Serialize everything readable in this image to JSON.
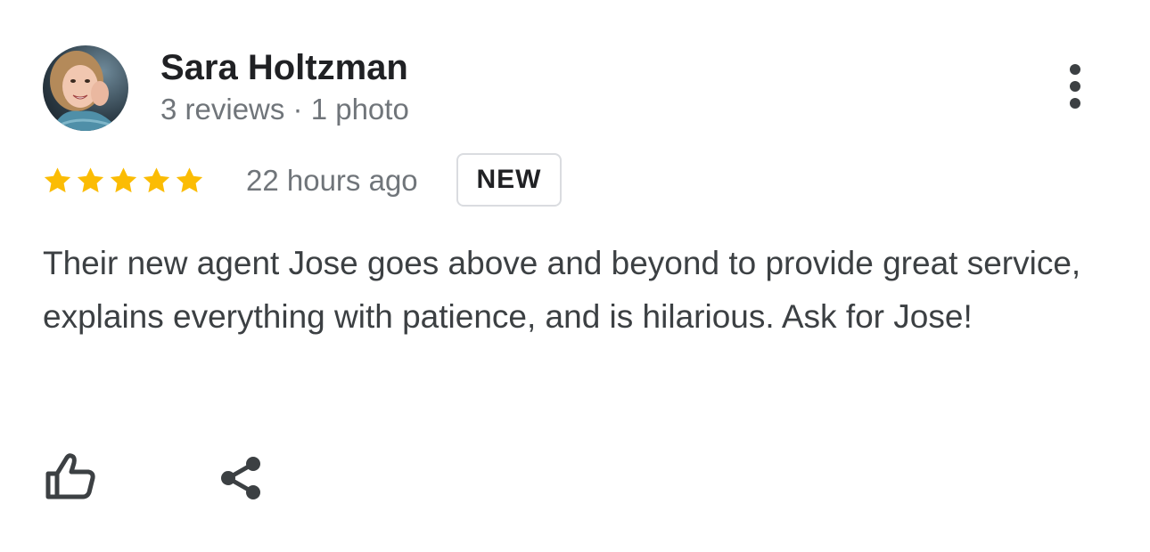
{
  "reviewer": {
    "name": "Sara Holtzman",
    "meta": "3 reviews · 1 photo",
    "avatar_icon": "user-avatar-photo"
  },
  "review": {
    "rating": 5,
    "max_rating": 5,
    "time_ago": "22 hours ago",
    "badge": "NEW",
    "text": "Their new agent Jose goes above and beyond to provide great service, explains everything with patience, and is hilarious. Ask for Jose!"
  },
  "actions": {
    "more_icon": "more-vert-icon",
    "like_icon": "thumb-up-icon",
    "share_icon": "share-icon"
  },
  "colors": {
    "star": "#fbbc04",
    "text_primary": "#202124",
    "text_secondary": "#70757a",
    "icon": "#3c4043",
    "badge_border": "#dadce0"
  }
}
